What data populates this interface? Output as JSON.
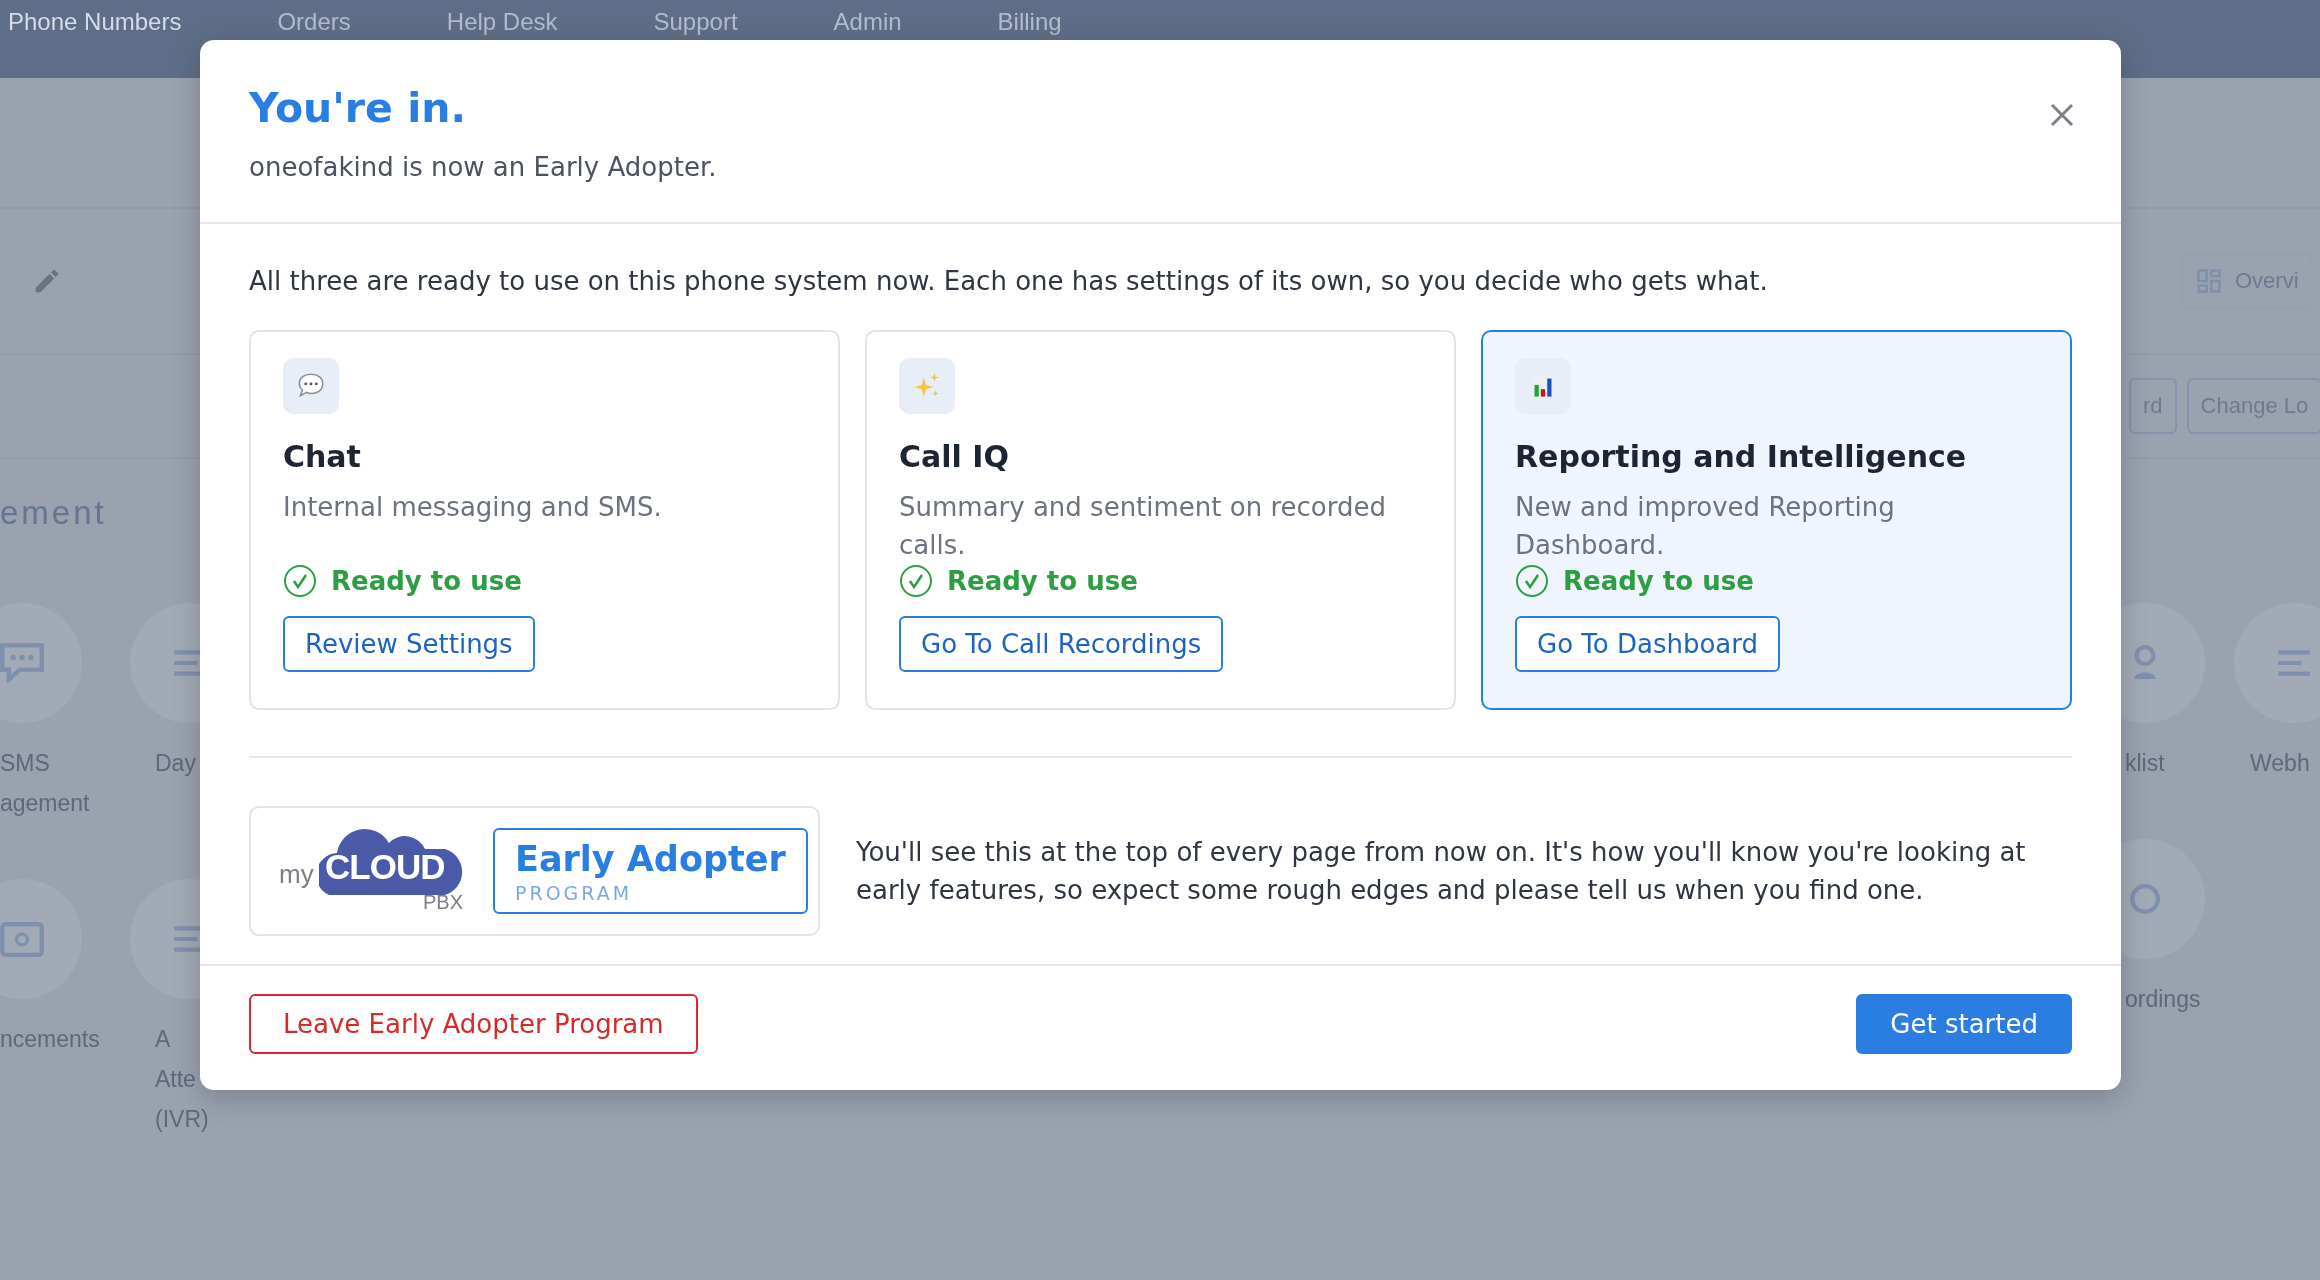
{
  "nav": {
    "items": [
      {
        "label": "Phone Numbers",
        "selected": true
      },
      {
        "label": "Orders",
        "selected": false
      },
      {
        "label": "Help Desk",
        "selected": false
      },
      {
        "label": "Support",
        "selected": false
      },
      {
        "label": "Admin",
        "selected": false
      },
      {
        "label": "Billing",
        "selected": false
      }
    ]
  },
  "background": {
    "left": {
      "heading": "ement",
      "tiles": [
        {
          "kind": "chat",
          "lines": [
            "SMS",
            "agement"
          ]
        },
        {
          "kind": "list",
          "lines": [
            "Day"
          ]
        },
        {
          "kind": "radio",
          "lines": [
            "ncements"
          ]
        },
        {
          "kind": "list",
          "lines": [
            "A",
            "Atte",
            "(IVR)"
          ]
        }
      ]
    },
    "right": {
      "buttons": [
        {
          "kind": "grid",
          "label": "Overvi"
        },
        {
          "kind": "plain",
          "label": "rd"
        },
        {
          "kind": "plain",
          "label": "Change Lo"
        }
      ],
      "tiles": [
        {
          "kind": "person",
          "lines": [
            "klist"
          ]
        },
        {
          "kind": "list",
          "lines": [
            "Webh"
          ]
        },
        {
          "kind": "circle",
          "lines": [
            "ordings"
          ]
        }
      ]
    }
  },
  "dialog": {
    "title": "You're in.",
    "subtitle": "oneofakind is now an Early Adopter.",
    "intro": "All three are ready to use on this phone system now. Each one has settings of its own, so you decide who gets what.",
    "features": [
      {
        "kind": "chat",
        "title": "Chat",
        "description": "Internal messaging and SMS.",
        "status": "Ready to use",
        "action": "Review Settings",
        "selected": false
      },
      {
        "kind": "sparkles",
        "title": "Call IQ",
        "description": "Summary and sentiment on recorded calls.",
        "status": "Ready to use",
        "action": "Go To Call Recordings",
        "selected": false
      },
      {
        "kind": "chart",
        "title": "Reporting and Intelligence",
        "description": "New and improved Reporting Dashboard.",
        "status": "Ready to use",
        "action": "Go To Dashboard",
        "selected": true
      }
    ],
    "badge": {
      "logo_prefix": "my",
      "logo_word": "CLOUD",
      "logo_suffix": "PBX",
      "title": "Early Adopter",
      "subtitle": "PROGRAM"
    },
    "badge_note": "You'll see this at the top of every page from now on. It's how you'll know you're looking at early features, so expect some rough edges and please tell us when you find one.",
    "footer": {
      "leave": "Leave Early Adopter Program",
      "primary": "Get started"
    }
  }
}
